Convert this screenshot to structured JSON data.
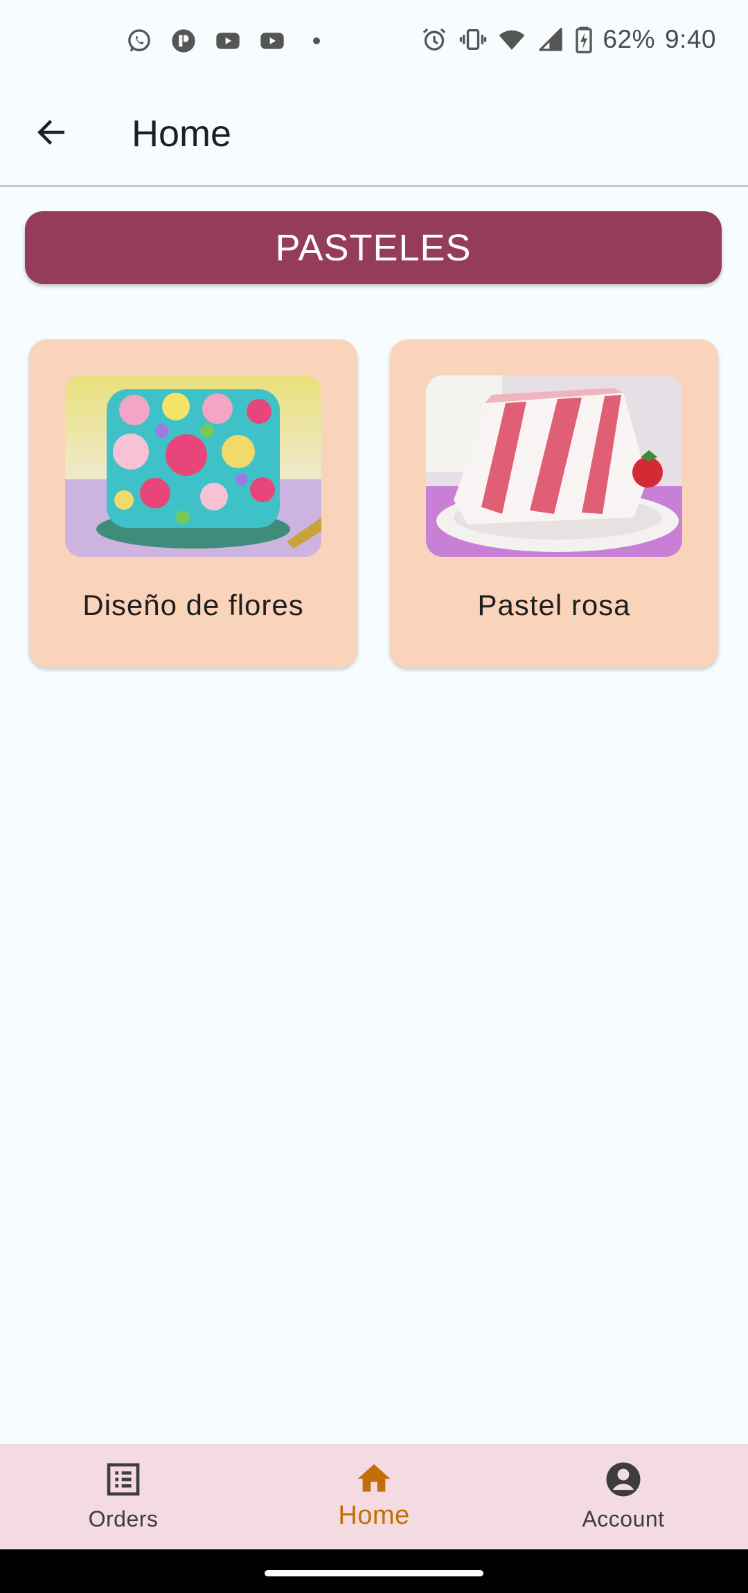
{
  "status_bar": {
    "left_icons": [
      "whatsapp-icon",
      "app-p-icon",
      "youtube-icon",
      "youtube-icon"
    ],
    "right_icons": [
      "alarm-icon",
      "vibrate-icon",
      "wifi-icon",
      "signal-icon",
      "battery-charging-icon"
    ],
    "battery": "62%",
    "time": "9:40"
  },
  "app_bar": {
    "title": "Home",
    "back_icon": "arrow-back-icon"
  },
  "category": {
    "title": "PASTELES",
    "color": "#963c5b"
  },
  "products": [
    {
      "name": "Diseño de flores",
      "image": "flower-cake-image"
    },
    {
      "name": "Pastel rosa",
      "image": "pink-cake-slice-image"
    }
  ],
  "bottom_nav": {
    "items": [
      {
        "label": "Orders",
        "icon": "list-icon",
        "active": false
      },
      {
        "label": "Home",
        "icon": "home-icon",
        "active": true
      },
      {
        "label": "Account",
        "icon": "account-circle-icon",
        "active": false
      }
    ],
    "active_color": "#c16f07",
    "background": "#f3dbe1"
  },
  "colors": {
    "background": "#f7fcff",
    "card": "#f9d4bb"
  }
}
